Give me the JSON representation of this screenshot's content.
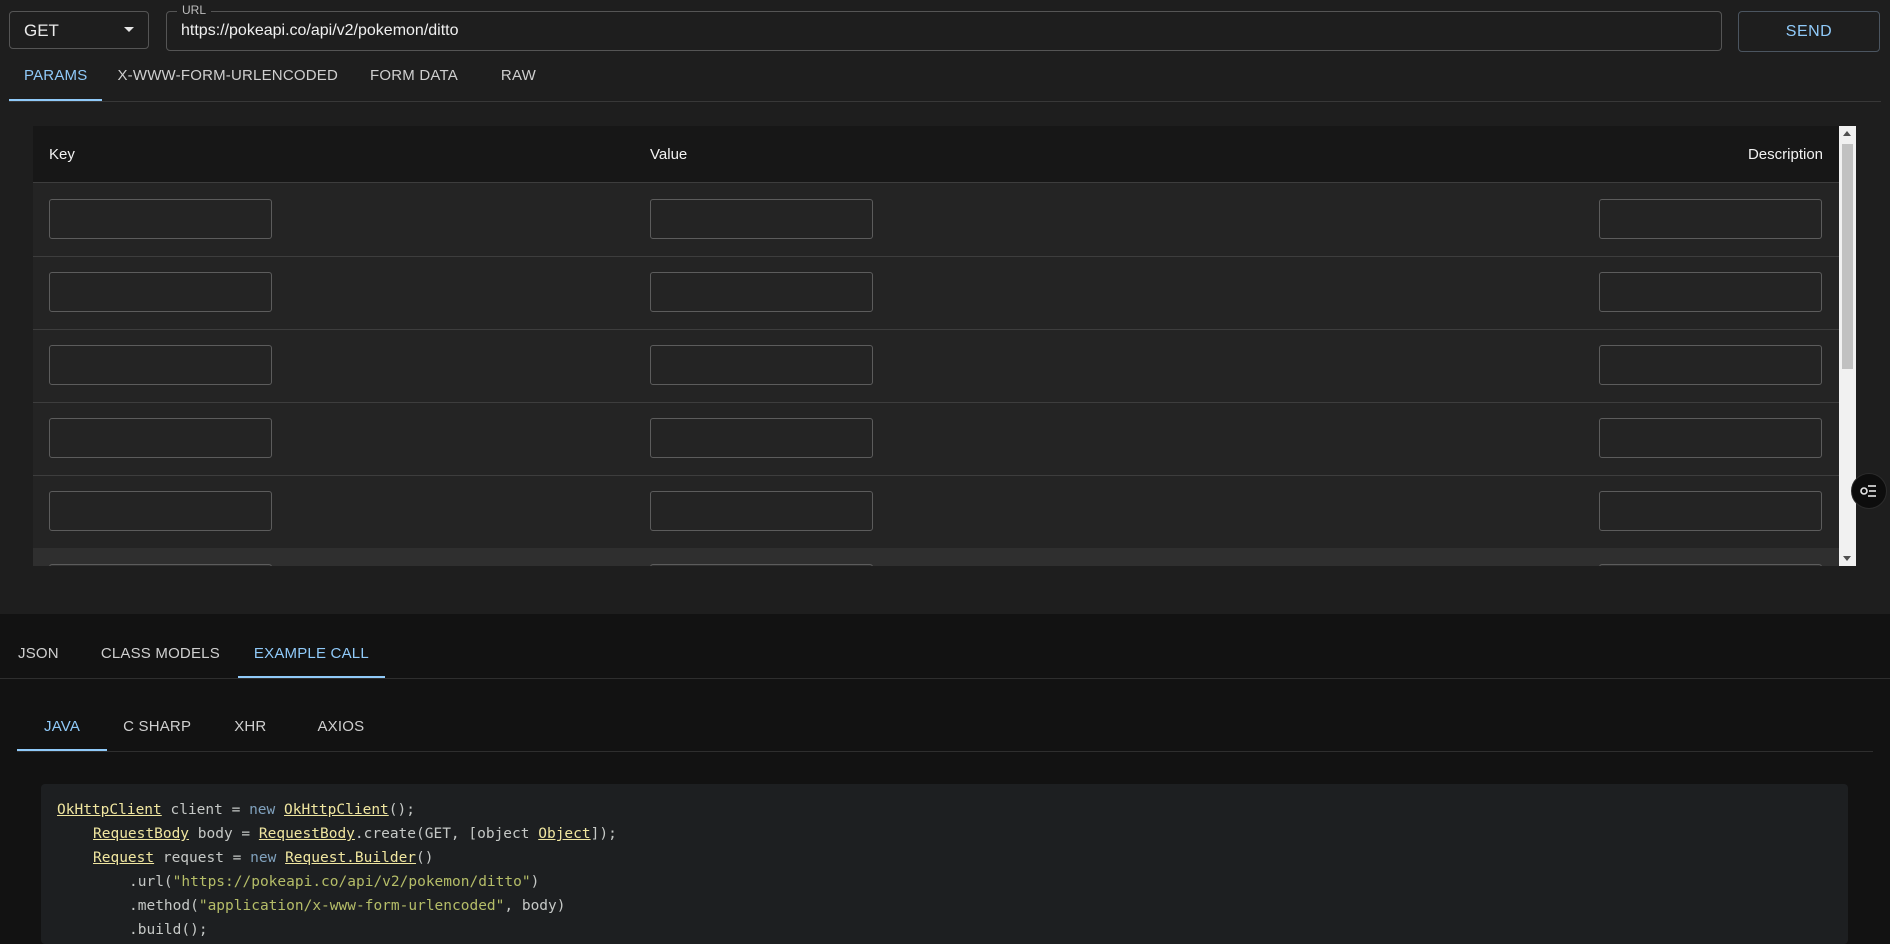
{
  "request": {
    "method": "GET",
    "url_label": "URL",
    "url": "https://pokeapi.co/api/v2/pokemon/ditto",
    "send_label": "SEND"
  },
  "param_tabs": [
    "PARAMS",
    "X-WWW-FORM-URLENCODED",
    "FORM DATA",
    "RAW"
  ],
  "param_tabs_active": "PARAMS",
  "params_table": {
    "headers": {
      "key": "Key",
      "value": "Value",
      "description": "Description"
    },
    "rows": [
      {
        "key": "",
        "value": "",
        "description": ""
      },
      {
        "key": "",
        "value": "",
        "description": ""
      },
      {
        "key": "",
        "value": "",
        "description": ""
      },
      {
        "key": "",
        "value": "",
        "description": ""
      },
      {
        "key": "",
        "value": "",
        "description": ""
      },
      {
        "key": "",
        "value": "",
        "description": ""
      }
    ]
  },
  "result_tabs": [
    "JSON",
    "CLASS MODELS",
    "EXAMPLE CALL"
  ],
  "result_tabs_active": "EXAMPLE CALL",
  "lang_tabs": [
    "JAVA",
    "C SHARP",
    "XHR",
    "AXIOS"
  ],
  "lang_tabs_active": "JAVA",
  "code": {
    "l1_t1": "OkHttpClient",
    "l1_a": " client = ",
    "l1_k": "new",
    "l1_sp": " ",
    "l1_t2": "OkHttpClient",
    "l1_b": "();",
    "l2_t1": "RequestBody",
    "l2_a": " body = ",
    "l2_t2": "RequestBody",
    "l2_b": ".create(GET, [object ",
    "l2_t3": "Object",
    "l2_c": "]);",
    "l3_t1": "Request",
    "l3_a": " request = ",
    "l3_k": "new",
    "l3_sp": " ",
    "l3_t2": "Request.Builder",
    "l3_b": "()",
    "l4_a": ".url(",
    "l4_s": "\"https://pokeapi.co/api/v2/pokemon/ditto\"",
    "l4_b": ")",
    "l5_a": ".method(",
    "l5_s": "\"application/x-www-form-urlencoded\"",
    "l5_b": ", body)",
    "l6_a": ".build();"
  },
  "colors": {
    "accent": "#90caf9",
    "panel": "#1e1e1e",
    "background": "#121212"
  },
  "icons": {
    "method_caret": "caret-down-icon",
    "float_button": "filter-list-icon"
  }
}
